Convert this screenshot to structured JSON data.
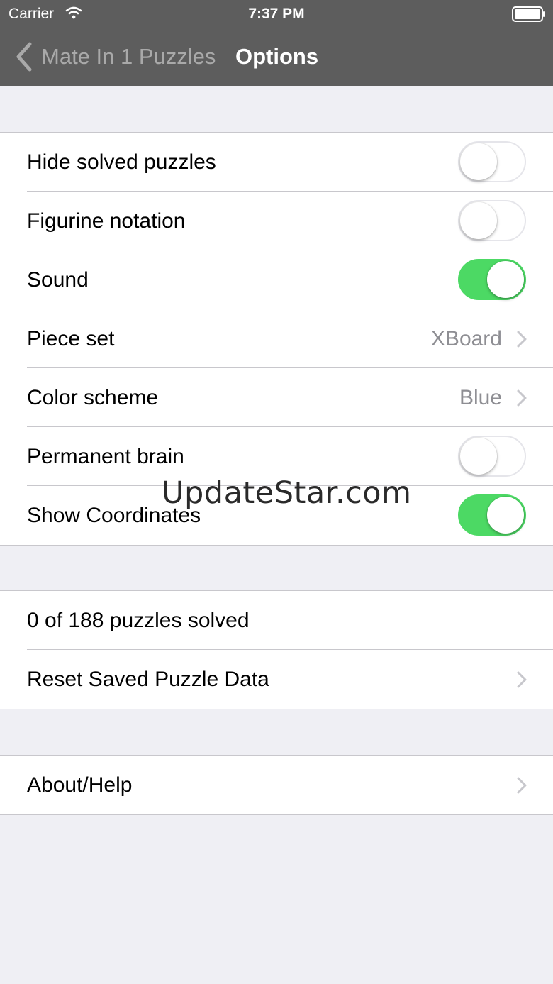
{
  "status_bar": {
    "carrier": "Carrier",
    "time": "7:37 PM"
  },
  "nav": {
    "back_label": "Mate In 1 Puzzles",
    "title": "Options"
  },
  "settings": {
    "hide_solved": {
      "label": "Hide solved puzzles",
      "enabled": false
    },
    "figurine_notation": {
      "label": "Figurine notation",
      "enabled": false
    },
    "sound": {
      "label": "Sound",
      "enabled": true
    },
    "piece_set": {
      "label": "Piece set",
      "value": "XBoard"
    },
    "color_scheme": {
      "label": "Color scheme",
      "value": "Blue"
    },
    "permanent_brain": {
      "label": "Permanent brain",
      "enabled": false
    },
    "show_coordinates": {
      "label": "Show Coordinates",
      "enabled": true
    }
  },
  "puzzles": {
    "solved_count": "0 of 188 puzzles solved",
    "reset_label": "Reset Saved Puzzle Data"
  },
  "about": {
    "label": "About/Help"
  },
  "watermark": "UpdateStar.com",
  "colors": {
    "toggle_on": "#4cd964",
    "nav_background": "#5d5d5d",
    "group_background": "#efeff4"
  },
  "icons": [
    "wifi-icon",
    "battery-icon",
    "back-chevron-icon",
    "chevron-right-icon"
  ]
}
